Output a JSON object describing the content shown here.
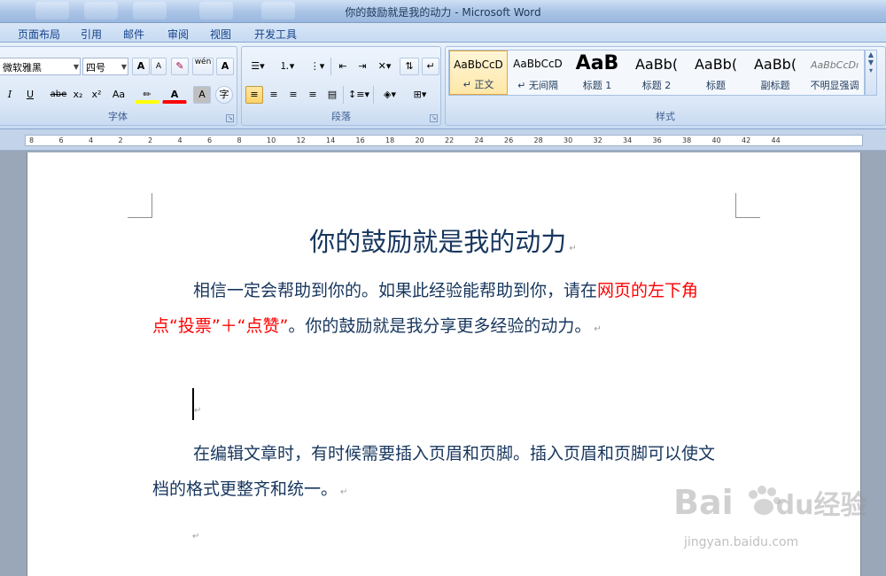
{
  "window": {
    "title": "你的鼓励就是我的动力 - Microsoft Word"
  },
  "tabs": [
    "页面布局",
    "引用",
    "邮件",
    "审阅",
    "视图",
    "开发工具"
  ],
  "font_group": {
    "label": "字体",
    "font_name": "微软雅黑",
    "font_size": "四号",
    "grow": "A",
    "shrink": "A",
    "aa": "Aa",
    "italic": "I",
    "underline": "U",
    "strike": "abe",
    "sub": "x₂",
    "sup": "x²",
    "font_color": "A",
    "char_shade": "A",
    "enclose": "字",
    "phonetic": "wén"
  },
  "paragraph_group": {
    "label": "段落"
  },
  "styles_group": {
    "label": "样式",
    "items": [
      {
        "sample": "AaBbCcD",
        "name": "↵ 正文"
      },
      {
        "sample": "AaBbCcD",
        "name": "↵ 无间隔"
      },
      {
        "sample": "AaB",
        "name": "标题 1"
      },
      {
        "sample": "AaBb(",
        "name": "标题 2"
      },
      {
        "sample": "AaBb(",
        "name": "标题"
      },
      {
        "sample": "AaBb(",
        "name": "副标题"
      },
      {
        "sample": "AaBbCcDı",
        "name": "不明显强调"
      }
    ]
  },
  "ruler": [
    "8",
    "6",
    "4",
    "2",
    "2",
    "4",
    "6",
    "8",
    "10",
    "12",
    "14",
    "16",
    "18",
    "20",
    "22",
    "24",
    "26",
    "28",
    "30",
    "32",
    "34",
    "36",
    "38",
    "40",
    "42",
    "44"
  ],
  "document": {
    "title": "你的鼓励就是我的动力",
    "p1_a": "相信一定会帮助到你的。如果此经验能帮助到你，请在",
    "p1_red1": "网页的",
    "p1_red2": "左下角点“投票”＋“点赞”",
    "p1_b": "。你的鼓励就是我分享更多经验的动",
    "p1_c": "力。",
    "p2_a": "在编辑文章时，有时候需要插入页眉和页脚。插入页眉和页脚",
    "p2_b": "可以使文档的格式更整齐和统一。",
    "para_mark": "↵"
  },
  "watermark": {
    "brand": "Bai",
    "brand2": "du",
    "cn": "经验",
    "url": "jingyan.baidu.com"
  }
}
